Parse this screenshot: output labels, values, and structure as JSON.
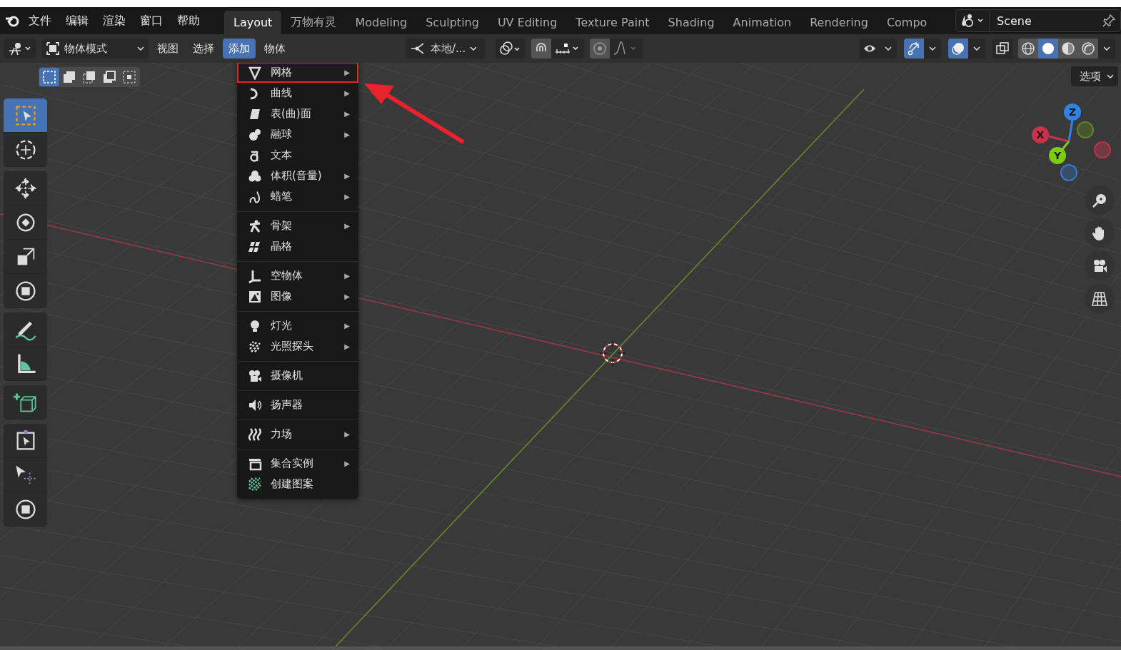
{
  "top_menu": [
    {
      "label": "文件"
    },
    {
      "label": "编辑"
    },
    {
      "label": "渲染"
    },
    {
      "label": "窗口"
    },
    {
      "label": "帮助"
    }
  ],
  "workspaces": [
    {
      "label": "Layout",
      "selected": true
    },
    {
      "label": "万物有灵",
      "selected": false
    },
    {
      "label": "Modeling",
      "selected": false
    },
    {
      "label": "Sculpting",
      "selected": false
    },
    {
      "label": "UV Editing",
      "selected": false
    },
    {
      "label": "Texture Paint",
      "selected": false
    },
    {
      "label": "Shading",
      "selected": false
    },
    {
      "label": "Animation",
      "selected": false
    },
    {
      "label": "Rendering",
      "selected": false
    },
    {
      "label": "Compo",
      "selected": false
    }
  ],
  "scene": {
    "name": "Scene"
  },
  "header": {
    "mode": "物体模式",
    "menus": [
      {
        "label": "视图",
        "selected": false
      },
      {
        "label": "选择",
        "selected": false
      },
      {
        "label": "添加",
        "selected": true
      },
      {
        "label": "物体",
        "selected": false
      }
    ],
    "orientation": "本地/...",
    "toggles": [
      {
        "selected": false
      },
      {
        "selected": true
      },
      {
        "selected": true
      },
      {
        "selected": false
      }
    ],
    "shading": [
      {
        "selected": false
      },
      {
        "selected": true
      },
      {
        "selected": false
      },
      {
        "selected": false
      }
    ]
  },
  "select_modes": [
    {
      "selected": true
    },
    {
      "selected": false
    },
    {
      "selected": false
    },
    {
      "selected": false
    },
    {
      "selected": false
    }
  ],
  "options": "选项",
  "toolbar": [
    [
      {
        "selected": true
      },
      {
        "selected": false
      }
    ],
    [
      {
        "selected": false
      },
      {
        "selected": false
      },
      {
        "selected": false
      },
      {
        "selected": false
      }
    ],
    [
      {
        "selected": false
      },
      {
        "selected": false
      }
    ],
    [
      {
        "selected": false
      }
    ],
    [
      {
        "selected": false
      },
      {
        "selected": false
      },
      {
        "selected": false
      }
    ]
  ],
  "add_menu": {
    "groups": [
      [
        {
          "label": "网格",
          "arrow": "▶",
          "annotated": true
        },
        {
          "label": "曲线",
          "arrow": "▶",
          "annotated": false
        },
        {
          "label": "表(曲)面",
          "arrow": "▶",
          "annotated": false
        },
        {
          "label": "融球",
          "arrow": "▶",
          "annotated": false
        },
        {
          "label": "文本",
          "annotated": false
        },
        {
          "label": "体积(音量)",
          "arrow": "▶",
          "annotated": false
        },
        {
          "label": "蜡笔",
          "arrow": "▶",
          "annotated": false
        }
      ],
      [
        {
          "label": "骨架",
          "arrow": "▶",
          "annotated": false
        },
        {
          "label": "晶格",
          "annotated": false
        }
      ],
      [
        {
          "label": "空物体",
          "arrow": "▶",
          "annotated": false
        },
        {
          "label": "图像",
          "arrow": "▶",
          "annotated": false
        }
      ],
      [
        {
          "label": "灯光",
          "arrow": "▶",
          "annotated": false
        },
        {
          "label": "光照探头",
          "arrow": "▶",
          "annotated": false
        }
      ],
      [
        {
          "label": "摄像机",
          "annotated": false
        }
      ],
      [
        {
          "label": "扬声器",
          "annotated": false
        }
      ],
      [
        {
          "label": "力场",
          "arrow": "▶",
          "annotated": false
        }
      ],
      [
        {
          "label": "集合实例",
          "arrow": "▶",
          "annotated": false
        },
        {
          "label": "创建图案",
          "annotated": false
        }
      ]
    ]
  },
  "gizmo": {
    "axes": [
      {
        "label": "Z",
        "color": "#2f83e6"
      },
      {
        "label": "X",
        "color": "#c8334a"
      },
      {
        "label": "Y",
        "color": "#7ccc14"
      }
    ]
  }
}
